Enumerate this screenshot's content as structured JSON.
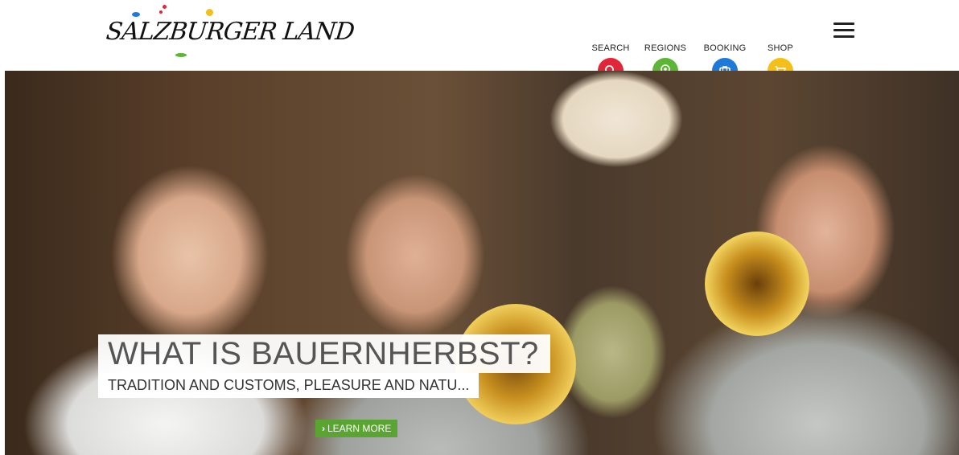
{
  "logo": {
    "text": "SALZBURGER LAND"
  },
  "nav": [
    {
      "label": "SEARCH",
      "icon": "search-icon",
      "color": "#e3253a"
    },
    {
      "label": "REGIONS",
      "icon": "location-pin-icon",
      "color": "#5cb535"
    },
    {
      "label": "BOOKING",
      "icon": "suitcase-icon",
      "color": "#1e7ad8"
    },
    {
      "label": "SHOP",
      "icon": "shopping-cart-icon",
      "color": "#f4bf18"
    }
  ],
  "menu": {
    "icon": "hamburger-menu-icon"
  },
  "hero": {
    "headline": "WHAT IS BAUERNHERBST?",
    "subheadline": "TRADITION AND CUSTOMS, PLEASURE AND NATU...",
    "cta_label": "LEARN MORE",
    "cta_color": "#5aa431"
  }
}
